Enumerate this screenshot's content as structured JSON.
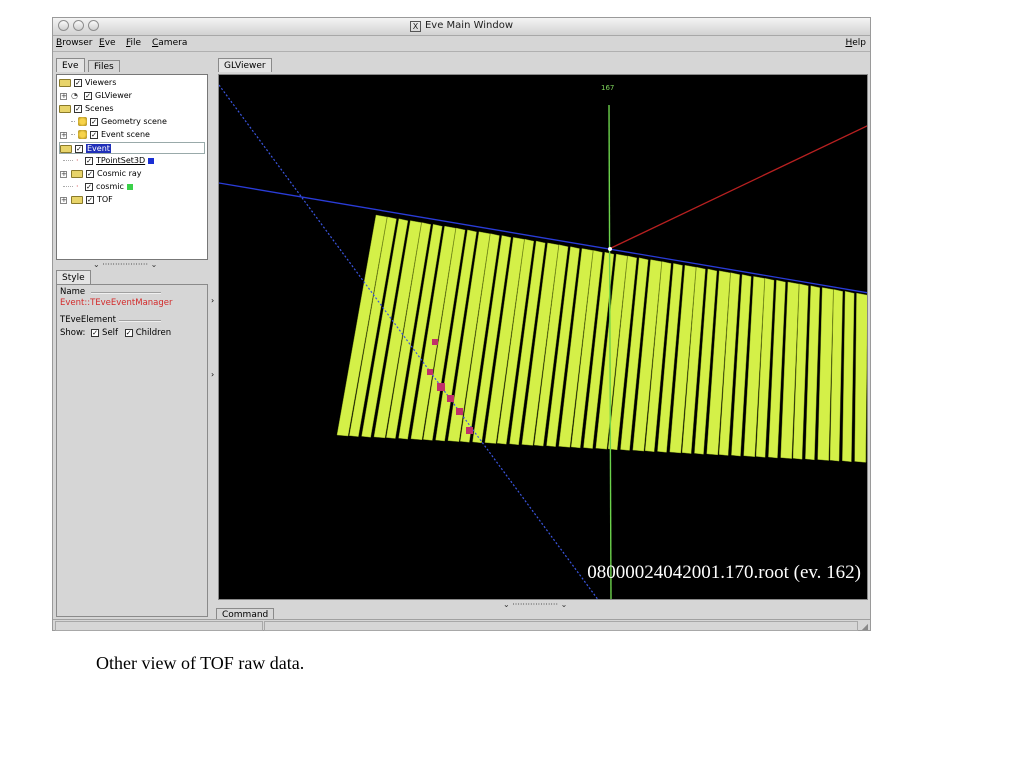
{
  "window": {
    "title": "Eve Main Window"
  },
  "menubar": {
    "items": [
      "Browser",
      "Eve",
      "File",
      "Camera"
    ],
    "help": "Help"
  },
  "left_tabs": [
    "Eve",
    "Files"
  ],
  "tree": {
    "items": [
      {
        "label": "Viewers",
        "icon": "folder-icon",
        "checked": true
      },
      {
        "label": "GLViewer",
        "icon": "eye-icon",
        "checked": true
      },
      {
        "label": "Scenes",
        "icon": "folder-icon",
        "checked": true
      },
      {
        "label": "Geometry scene",
        "icon": "scene-icon",
        "checked": true
      },
      {
        "label": "Event scene",
        "icon": "scene-icon",
        "checked": true
      },
      {
        "label": "Event",
        "icon": "folder-icon",
        "checked": true,
        "selected": true
      },
      {
        "label": "TPointSet3D",
        "icon": "pointset-icon",
        "checked": true,
        "color": "#1a2fd4"
      },
      {
        "label": "Cosmic ray",
        "icon": "folder-icon",
        "checked": true
      },
      {
        "label": "cosmic",
        "icon": "pointset-icon",
        "checked": true,
        "color": "#3bd14a"
      },
      {
        "label": "TOF",
        "icon": "folder-icon",
        "checked": true
      }
    ]
  },
  "style_tab": "Style",
  "editor": {
    "name_label": "Name",
    "name_value": "Event::TEveEventManager",
    "element_label": "TEveElement",
    "show_label": "Show:",
    "self_label": "Self",
    "children_label": "Children",
    "self_checked": true,
    "children_checked": true
  },
  "viewer_tab": "GLViewer",
  "viewer": {
    "axis_label": "167",
    "file_label": "08000024042001.170.root (ev. 162)",
    "colors": {
      "background": "#000000",
      "bars": "#d4f048",
      "blue_line": "#2a3cd8",
      "red_line": "#b82020",
      "green_line": "#6cd24c",
      "hits": "#c0306a"
    }
  },
  "command_tab": "Command",
  "caption": "Other view of TOF raw data."
}
